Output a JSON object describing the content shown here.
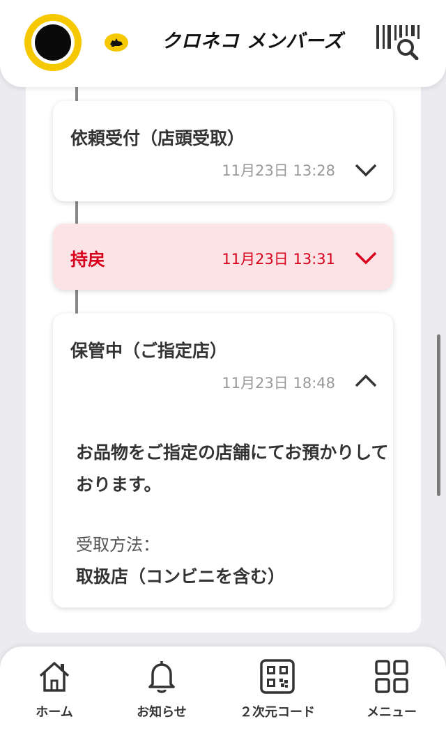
{
  "header": {
    "app_title": "クロネコ メンバーズ",
    "avatar_icon": "user-avatar",
    "logo_icon": "black-cat-logo-icon",
    "scan_icon": "barcode-search-icon",
    "brand_color": "#f5c800"
  },
  "timeline": [
    {
      "title": "依頼受付（店頭受取）",
      "time": "11月23日 13:28",
      "expanded": false,
      "highlight": false
    },
    {
      "title": "持戻",
      "time": "11月23日 13:31",
      "expanded": false,
      "highlight": true,
      "highlight_color": "#d8001c"
    },
    {
      "title": "保管中（ご指定店）",
      "time": "11月23日 18:48",
      "expanded": true,
      "highlight": false,
      "detail": {
        "message": "お品物をご指定の店舗にてお預かりしております。",
        "method_label": "受取方法：",
        "method_value": "取扱店（コンビニを含む）"
      }
    }
  ],
  "nav": {
    "items": [
      {
        "label": "ホーム",
        "icon": "home-icon"
      },
      {
        "label": "お知らせ",
        "icon": "bell-icon"
      },
      {
        "label": "２次元コード",
        "icon": "qr-code-icon"
      },
      {
        "label": "メニュー",
        "icon": "grid-menu-icon"
      }
    ]
  }
}
